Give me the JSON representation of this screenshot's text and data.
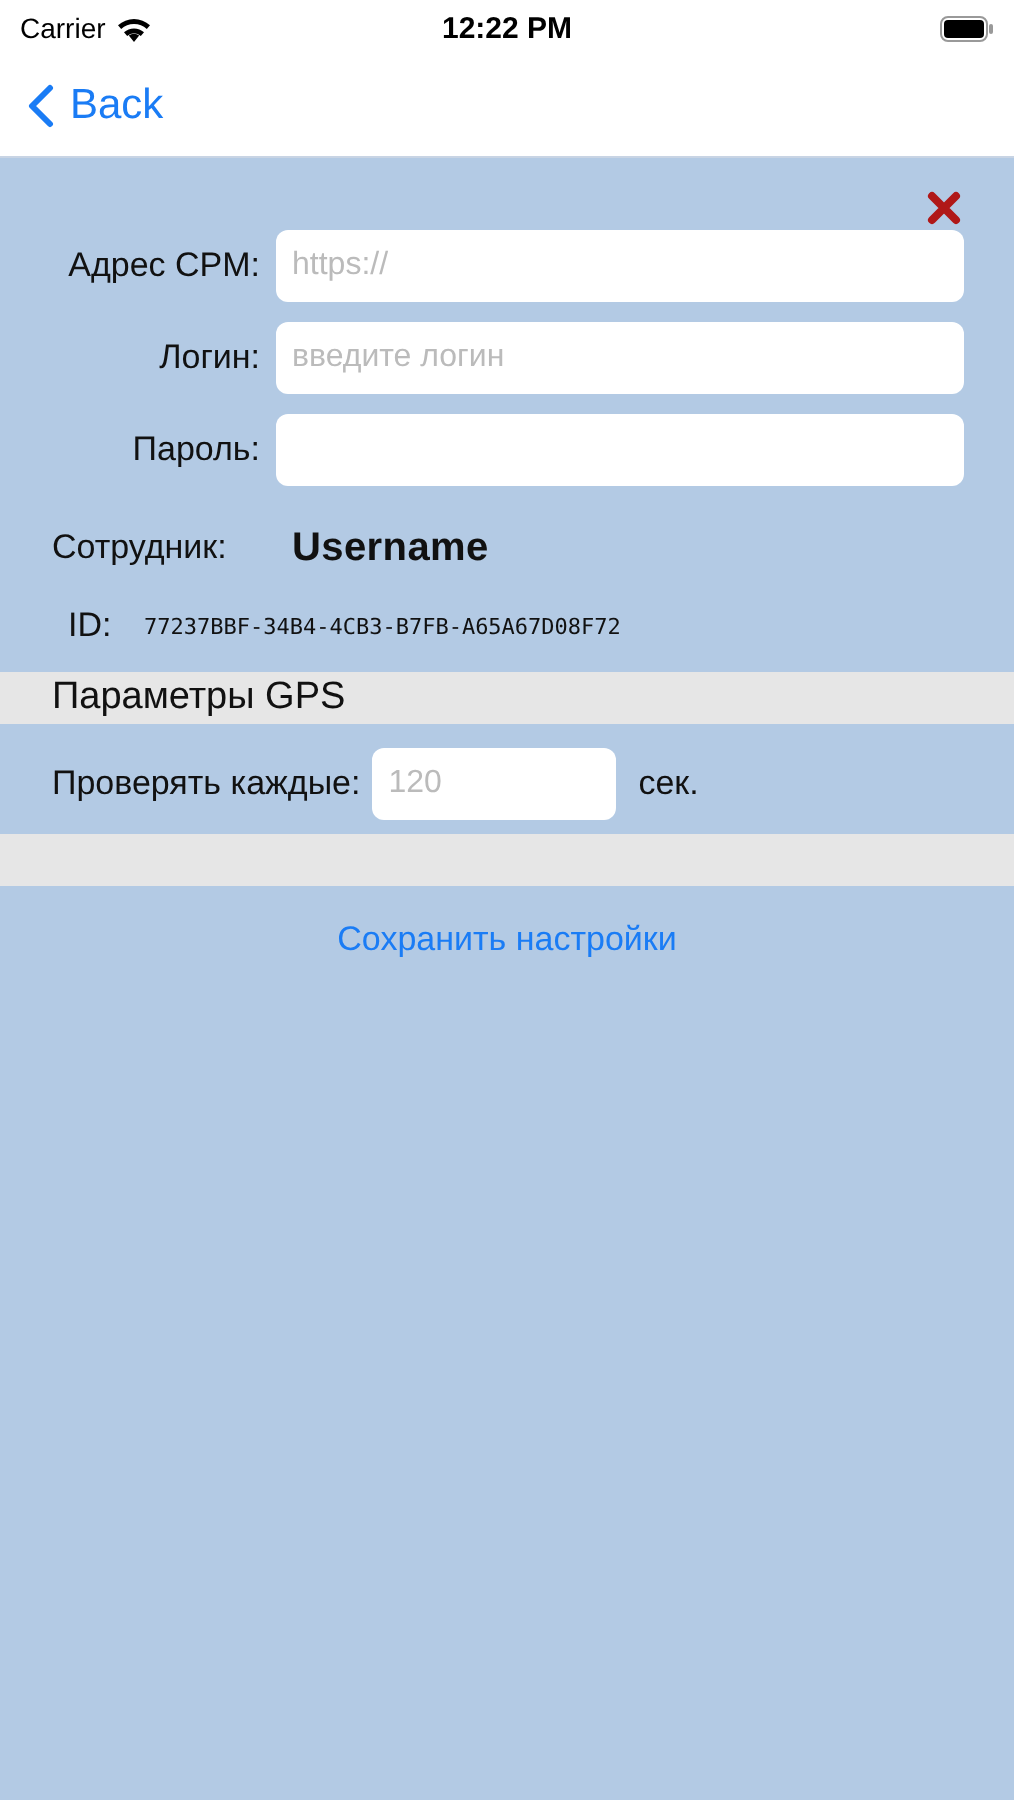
{
  "status_bar": {
    "carrier": "Carrier",
    "time": "12:22 PM"
  },
  "nav_bar": {
    "back_label": "Back"
  },
  "form": {
    "fields": [
      {
        "label": "Адрес CPM:",
        "placeholder": "https://"
      },
      {
        "label": "Логин:",
        "placeholder": "введите логин"
      },
      {
        "label": "Пароль:"
      }
    ],
    "employee": {
      "label": "Сотрудник:",
      "value": "Username"
    },
    "device_id": {
      "label": "ID:",
      "value": "77237BBF-34B4-4CB3-B7FB-A65A67D08F72"
    }
  },
  "gps": {
    "title": "Параметры GPS",
    "interval": {
      "label": "Проверять каждые:",
      "placeholder": "120",
      "unit": "сек."
    }
  },
  "save_button": "Сохранить настройки"
}
